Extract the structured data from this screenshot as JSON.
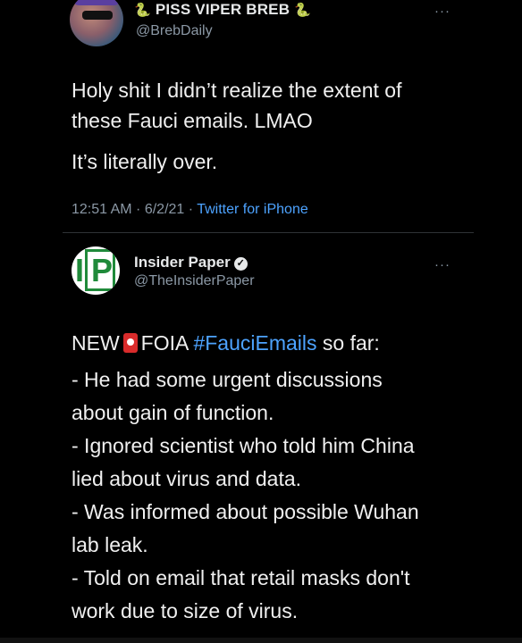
{
  "tweet1": {
    "name": "PISS VIPER BREB",
    "name_prefix_icon": "snake-icon",
    "name_suffix_icon": "snake-icon",
    "handle": "@BrebDaily",
    "more": "···",
    "line1": "Holy shit I didn’t realize the extent of",
    "line2": "these Fauci emails. LMAO",
    "line3": "It’s literally over.",
    "time": "12:51 AM · 6/2/21 · ",
    "source": "Twitter for iPhone"
  },
  "tweet2": {
    "name": "Insider Paper",
    "handle": "@TheInsiderPaper",
    "more": "···",
    "avatar_text": "IP",
    "intro_new": "NEW",
    "intro_foia": "FOIA",
    "hashtag": "#FauciEmails",
    "intro_tail": " so far:",
    "lines": [
      "- He had some urgent discussions",
      "about gain of function.",
      "- Ignored scientist who told him China",
      "lied about virus and data.",
      "- Was informed about possible Wuhan",
      "lab leak.",
      "- Told on email that retail masks don't",
      "work due to size of virus."
    ],
    "emoji": "fire-extinguisher-icon"
  },
  "colors": {
    "background": "#000000",
    "text": "#e7e9ea",
    "muted": "#8b98a5",
    "link": "#4da3ff"
  }
}
